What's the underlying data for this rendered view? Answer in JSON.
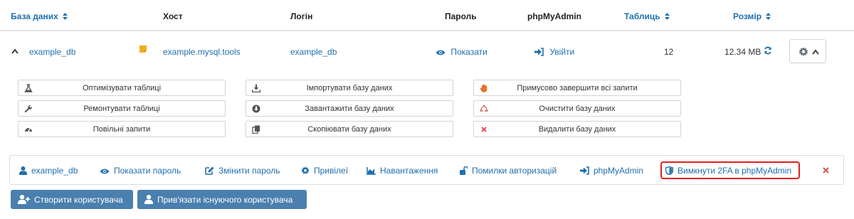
{
  "header": {
    "database": "База даних",
    "host": "Хост",
    "login": "Логін",
    "password": "Пароль",
    "phpmyadmin": "phpMyAdmin",
    "tables": "Таблиць",
    "size": "Розмір"
  },
  "db_row": {
    "name": "example_db",
    "host": "example.mysql.tools",
    "login": "example_db",
    "password_action": "Показати",
    "pma_action": "Увійти",
    "tables": "12",
    "size": "12.34 MB"
  },
  "actions": {
    "optimize": "Оптимізувати таблиці",
    "repair": "Ремонтувати таблиці",
    "slow_queries": "Повільні запити",
    "import": "Імпортувати базу даних",
    "download": "Завантажити базу даних",
    "copy": "Скопіювати базу даних",
    "kill_queries": "Примусово завершити всі запити",
    "clear": "Очистити базу даних",
    "delete": "Видалити базу даних"
  },
  "user_panel": {
    "user": "example_db",
    "show_password": "Показати пароль",
    "change_password": "Змінити пароль",
    "privileges": "Привілеї",
    "load": "Навантаження",
    "auth_errors": "Помилки авторизацій",
    "phpmyadmin": "phpMyAdmin",
    "disable_2fa": "Вимкнути 2FA в phpMyAdmin"
  },
  "buttons": {
    "create_user": "Створити користувача",
    "bind_user": "Прив'язати існуючого користувача"
  },
  "colors": {
    "link": "#1f6fae",
    "button": "#4a7fae",
    "highlight": "#e02020",
    "delete": "#d9534f",
    "note": "#f0ad1e"
  }
}
